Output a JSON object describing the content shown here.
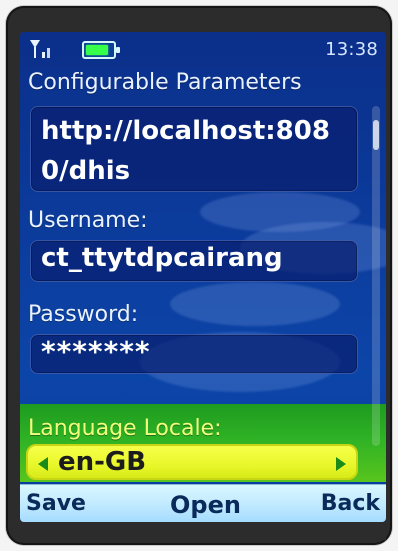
{
  "status": {
    "time": "13:38",
    "signal_icon": "signal-icon",
    "battery_icon": "battery-icon"
  },
  "screen": {
    "title": "Configurable Parameters",
    "server_url": "http://localhost:8080/dhis",
    "username_label": "Username:",
    "username_value": "ct_ttytdpcairang",
    "password_label": "Password:",
    "password_value": "*******",
    "language_label": "Language Locale:",
    "language_value": "en-GB"
  },
  "softkeys": {
    "left": "Save",
    "middle": "Open",
    "right": "Back"
  },
  "colors": {
    "screen_blue": "#0b3a9a",
    "focus_green": "#2fb225",
    "locale_yellow": "#e8f72a",
    "softkey_bg": "#bfe9ff"
  }
}
